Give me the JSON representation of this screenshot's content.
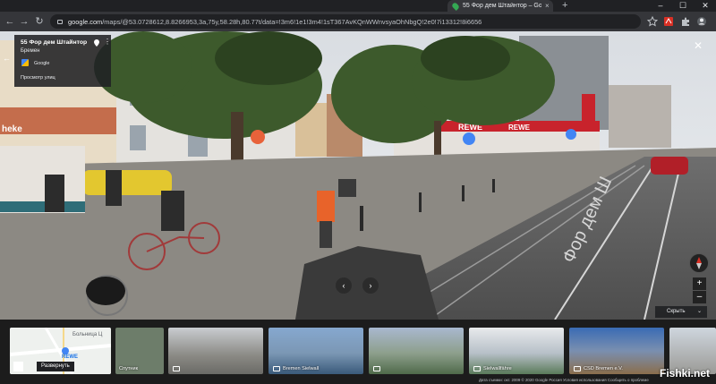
{
  "browser": {
    "tab_title": "55 Фор дем Штайнтор – Google",
    "tab_close": "×",
    "new_tab": "+",
    "url_host": "google.com",
    "url_path": "/maps/@53.0728612,8.8266953,3a,75y,58.28h,80.77t/data=!3m6!1e1!3m4!1sT367AvKQnWWnvsyaOhNbgQ!2e0!7i13312!8i6656",
    "win_min": "–",
    "win_max": "☐",
    "win_close": "✕"
  },
  "infocard": {
    "title": "55 Фор дем Штайнтор",
    "subtitle": "Бремен",
    "attribution": "Google",
    "link": "Просмотр улиц",
    "more": "⋮"
  },
  "controls": {
    "close": "✕",
    "zoom_in": "+",
    "zoom_out": "–",
    "collapse_label": "Скрыть",
    "collapse_chevron": "⌄",
    "nav_left": "‹",
    "nav_right": "›"
  },
  "map_thumb": {
    "street_label": "Больница Ц",
    "place_label": "REWE",
    "expand_label": "Развернуть"
  },
  "thumbnails": [
    {
      "label": "Спутник"
    },
    {
      "label": ""
    },
    {
      "label": "Bremen Sielwall"
    },
    {
      "label": ""
    },
    {
      "label": "Sielwallfähre"
    },
    {
      "label": "CSD Bremen e.V."
    },
    {
      "label": ""
    }
  ],
  "footer": "Дата съемки: окт. 2009   © 2020 Google   Россия   Условия использования   Сообщить о проблеме",
  "watermark": "Fishki.net",
  "colors": {
    "chrome_dark": "#202124",
    "chrome_mid": "#35363a",
    "rewe_red": "#c8232c",
    "map_pin": "#4285f4"
  }
}
